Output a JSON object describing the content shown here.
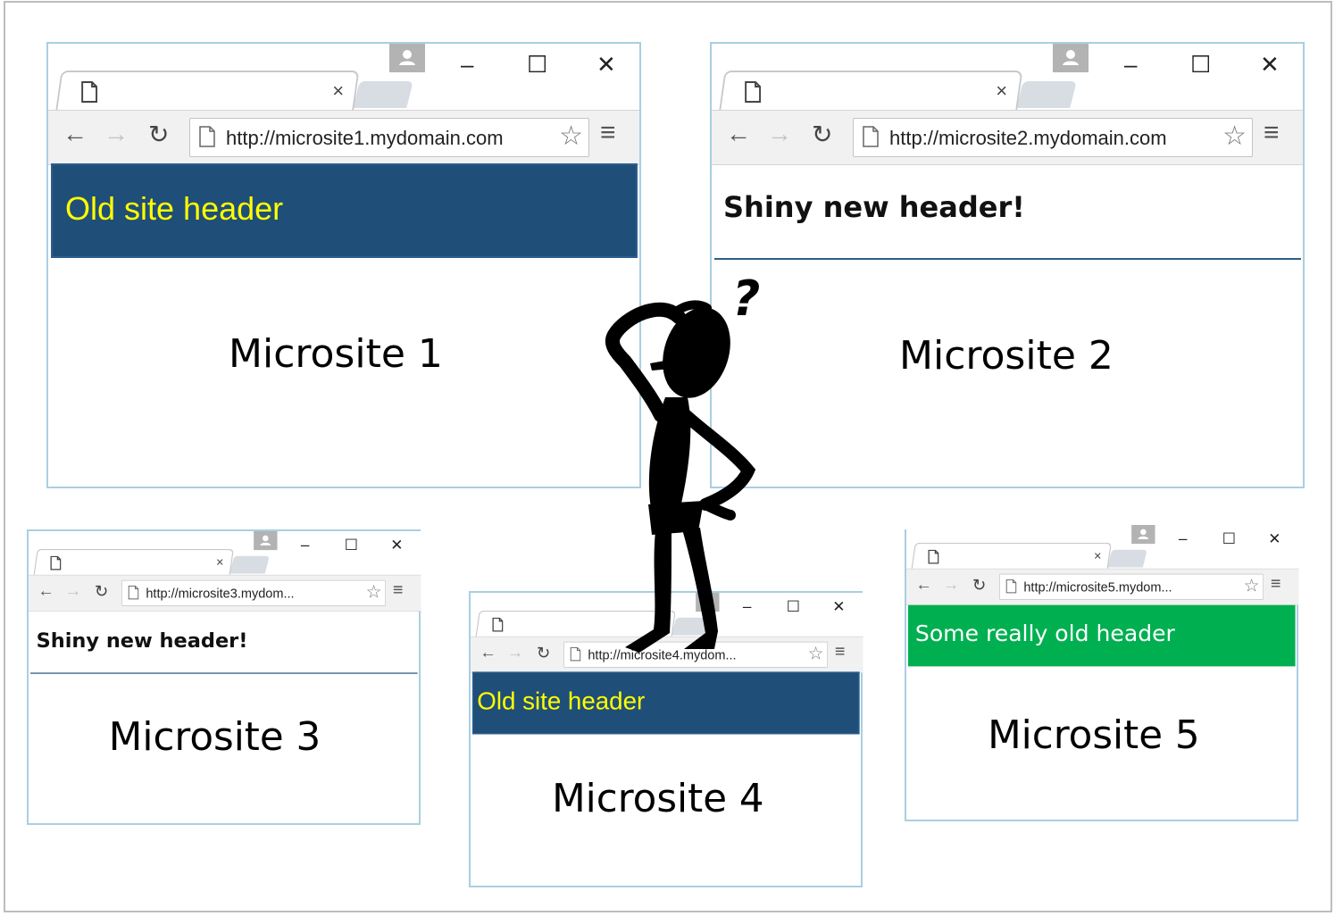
{
  "windows": [
    {
      "url": "http://microsite1.mydomain.com",
      "header": "Old site header",
      "header_style": "old",
      "label": "Microsite 1"
    },
    {
      "url": "http://microsite2.mydomain.com",
      "header": "Shiny new header!",
      "header_style": "new",
      "label": "Microsite 2"
    },
    {
      "url": "http://microsite3.mydom...",
      "header": "Shiny new header!",
      "header_style": "new",
      "label": "Microsite 3"
    },
    {
      "url": "http://microsite4.mydom...",
      "header": "Old site header",
      "header_style": "old",
      "label": "Microsite 4"
    },
    {
      "url": "http://microsite5.mydom...",
      "header": "Some really old header",
      "header_style": "green",
      "label": "Microsite 5"
    }
  ],
  "browser_controls": {
    "tab_close": "×",
    "minimize": "–",
    "maximize": "☐",
    "close": "✕",
    "back": "←",
    "forward": "→",
    "reload": "↻",
    "star": "☆",
    "menu": "≡"
  },
  "figure": {
    "question_mark": "?",
    "icon": "confused-stick-figure-icon"
  },
  "colors": {
    "old_header_bg": "#1f4e79",
    "old_header_text": "#ffff00",
    "green_header_bg": "#00b050",
    "window_border": "#a9cfe0"
  }
}
